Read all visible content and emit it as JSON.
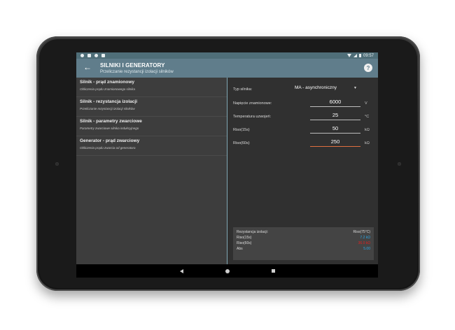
{
  "status_bar": {
    "time": "09:57"
  },
  "app_bar": {
    "title": "SILNIKI I GENERATORY",
    "subtitle": "Przeliczanie rezystancji izolacji silników"
  },
  "list": {
    "items": [
      {
        "title": "Silnik - prąd znamionowy",
        "subtitle": "Obliczenia prądu znamionowego silnika"
      },
      {
        "title": "Silnik - rezystancja izolacji",
        "subtitle": "Przeliczanie rezystancji izolacji silników"
      },
      {
        "title": "Silnik - parametry zwarciowe",
        "subtitle": "Parametry zwarciowe silnika indukcyjnego"
      },
      {
        "title": "Generator - prąd zwarciowy",
        "subtitle": "Obliczenia prądu zwarcia od generatora"
      }
    ]
  },
  "form": {
    "motor_type": {
      "label": "Typ silnika:",
      "value": "MA - asynchroniczny"
    },
    "voltage": {
      "label": "Napięcie znamionowe:",
      "value": "6000",
      "unit": "V"
    },
    "temperature": {
      "label": "Temperatura uzwojeń:",
      "value": "25",
      "unit": "°C"
    },
    "riso15": {
      "label": "Riso(15s)",
      "value": "50",
      "unit": "kΩ"
    },
    "riso60": {
      "label": "Riso(60s)",
      "value": "250",
      "unit": "kΩ"
    }
  },
  "results": {
    "header_left": "Rezystancja izolacji:",
    "header_right": "Riso(75°C)",
    "rows": [
      {
        "label": "Riso(15s)",
        "value": "7.2 kΩ",
        "color": "#2aa8e8"
      },
      {
        "label": "Riso(60s)",
        "value": "36.0 kΩ",
        "color": "#e02020"
      },
      {
        "label": "Abs",
        "value": "5.00",
        "color": "#2aa8e8"
      }
    ]
  },
  "colors": {
    "appbar": "#607d8b",
    "statusbar": "#4f6e78",
    "active_underline": "#e07040"
  }
}
